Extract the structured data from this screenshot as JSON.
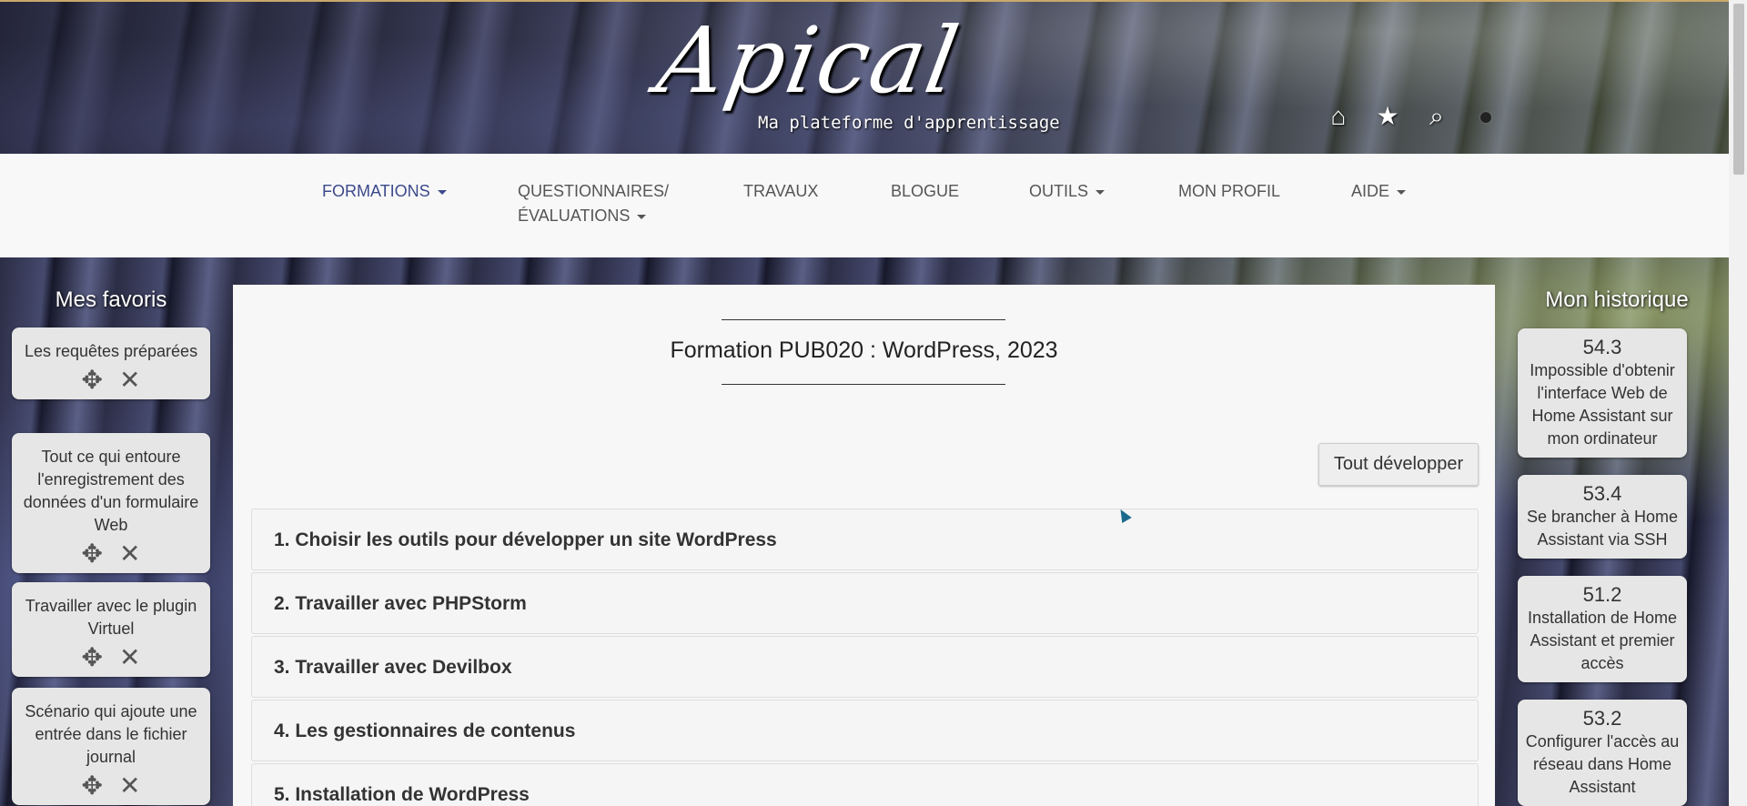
{
  "header": {
    "logo_text": "Apical",
    "tagline": "Ma plateforme d'apprentissage",
    "icons": [
      "home-icon",
      "star-icon",
      "search-icon",
      "user-icon"
    ]
  },
  "nav": {
    "items": [
      {
        "label": "FORMATIONS",
        "dropdown": true,
        "active": true
      },
      {
        "label_line1": "QUESTIONNAIRES/",
        "label_line2": "ÉVALUATIONS",
        "dropdown": true
      },
      {
        "label": "TRAVAUX"
      },
      {
        "label": "BLOGUE"
      },
      {
        "label": "OUTILS",
        "dropdown": true
      },
      {
        "label": "MON PROFIL"
      },
      {
        "label": "AIDE",
        "dropdown": true
      }
    ]
  },
  "favorites": {
    "title": "Mes favoris",
    "items": [
      "Les requêtes préparées",
      "Tout ce qui entoure l'enregistrement des données d'un formulaire Web",
      "Travailler avec le plugin Virtuel",
      "Scénario qui ajoute une entrée dans le fichier journal"
    ]
  },
  "history": {
    "title": "Mon historique",
    "items": [
      {
        "num": "54.3",
        "text": "Impossible d'obtenir l'interface Web de Home Assistant sur mon ordinateur"
      },
      {
        "num": "53.4",
        "text": "Se brancher à Home Assistant via SSH"
      },
      {
        "num": "51.2",
        "text": "Installation de Home Assistant et premier accès"
      },
      {
        "num": "53.2",
        "text": "Configurer l'accès au réseau dans Home Assistant"
      }
    ]
  },
  "main": {
    "title": "Formation PUB020 : WordPress, 2023",
    "expand_label": "Tout développer",
    "sections": [
      "1. Choisir les outils pour développer un site WordPress",
      "2. Travailler avec PHPStorm",
      "3. Travailler avec Devilbox",
      "4. Les gestionnaires de contenus",
      "5. Installation de WordPress"
    ]
  },
  "colors": {
    "nav_active": "#3c4a8c",
    "nav_text": "#555555",
    "card_bg": "#e6e6e6",
    "main_bg": "#f7f7f7"
  }
}
